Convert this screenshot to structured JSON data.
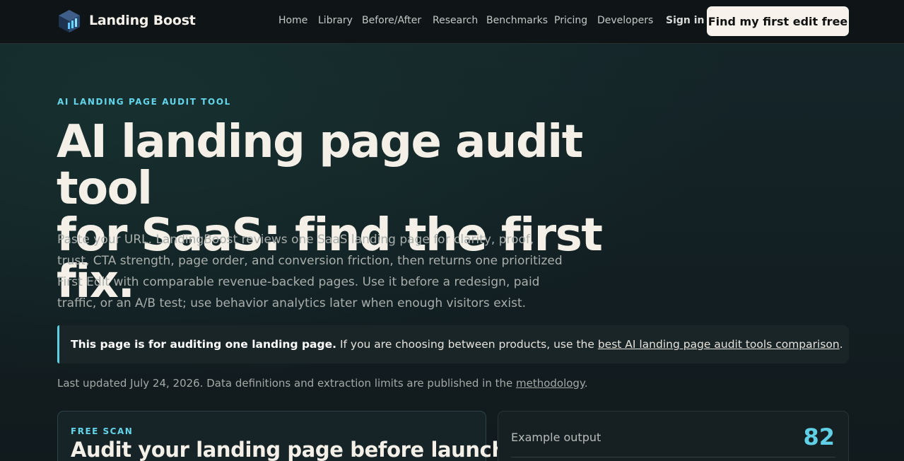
{
  "header": {
    "brand": "Landing Boost",
    "nav": [
      "Home",
      "Library",
      "Before/After",
      "Research",
      "Benchmarks",
      "Pricing",
      "Developers"
    ],
    "signin": "Sign in",
    "cta": "Find my first edit free"
  },
  "hero": {
    "eyebrow": "AI LANDING PAGE AUDIT TOOL",
    "title_line1": "AI landing page audit tool",
    "title_line2": "for SaaS: find the first fix.",
    "lede": "Paste your URL. LandingBoost reviews one SaaS landing page for clarity, proof, trust, CTA strength, page order, and conversion friction, then returns one prioritized First Edit with comparable revenue-backed pages. Use it before a redesign, paid traffic, or an A/B test; use behavior analytics later when enough visitors exist."
  },
  "notice": {
    "strong": "This page is for auditing one landing page.",
    "text": " If you are choosing between products, use the ",
    "link": "best AI landing page audit tools comparison",
    "end": "."
  },
  "updated": {
    "text": "Last updated July 24, 2026. Data definitions and extraction limits are published in the ",
    "link": "methodology",
    "end": "."
  },
  "scan_card": {
    "tag": "FREE SCAN",
    "title": "Audit your landing page before launch."
  },
  "example_card": {
    "label": "Example output",
    "score": "82"
  },
  "colors": {
    "accent": "#63d5ea",
    "background": "#121c1f",
    "cta_bg": "#f7f3ec"
  }
}
